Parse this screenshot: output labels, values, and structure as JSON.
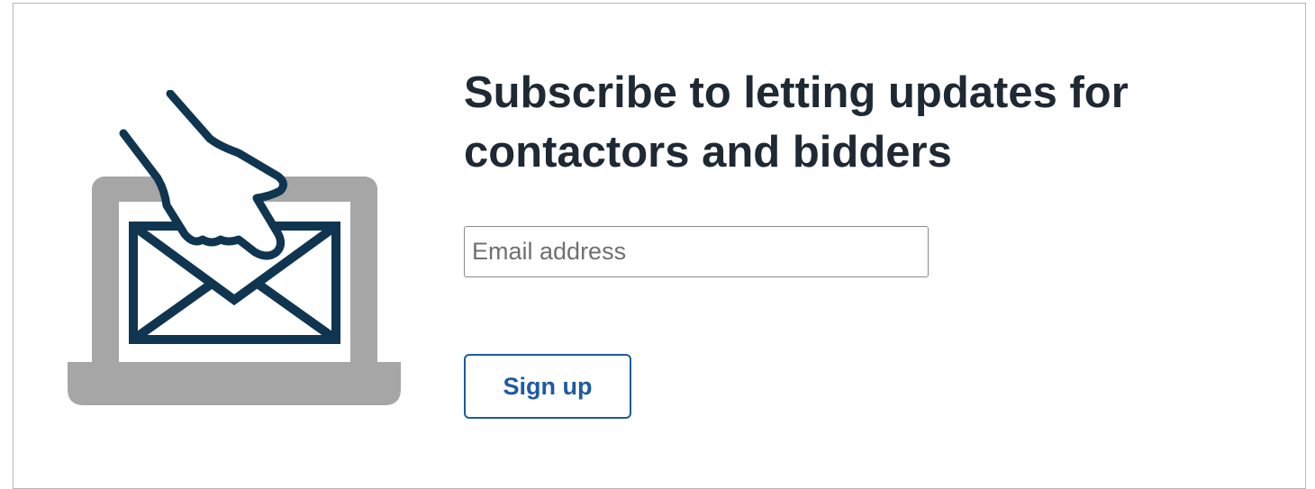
{
  "subscribe": {
    "heading": "Subscribe to letting updates for contactors and bidders",
    "email_placeholder": "Email address",
    "email_value": "",
    "signup_label": "Sign up"
  },
  "illustration": {
    "icon": "laptop-envelope-hand-icon",
    "colors": {
      "laptop": "#a6a6a6",
      "screen": "#ffffff",
      "envelope_stroke": "#0f3550",
      "hand_stroke": "#0f3550"
    }
  },
  "colors": {
    "heading_text": "#1f2933",
    "button_accent": "#1e5aa0",
    "field_border": "#8a8a8a"
  }
}
